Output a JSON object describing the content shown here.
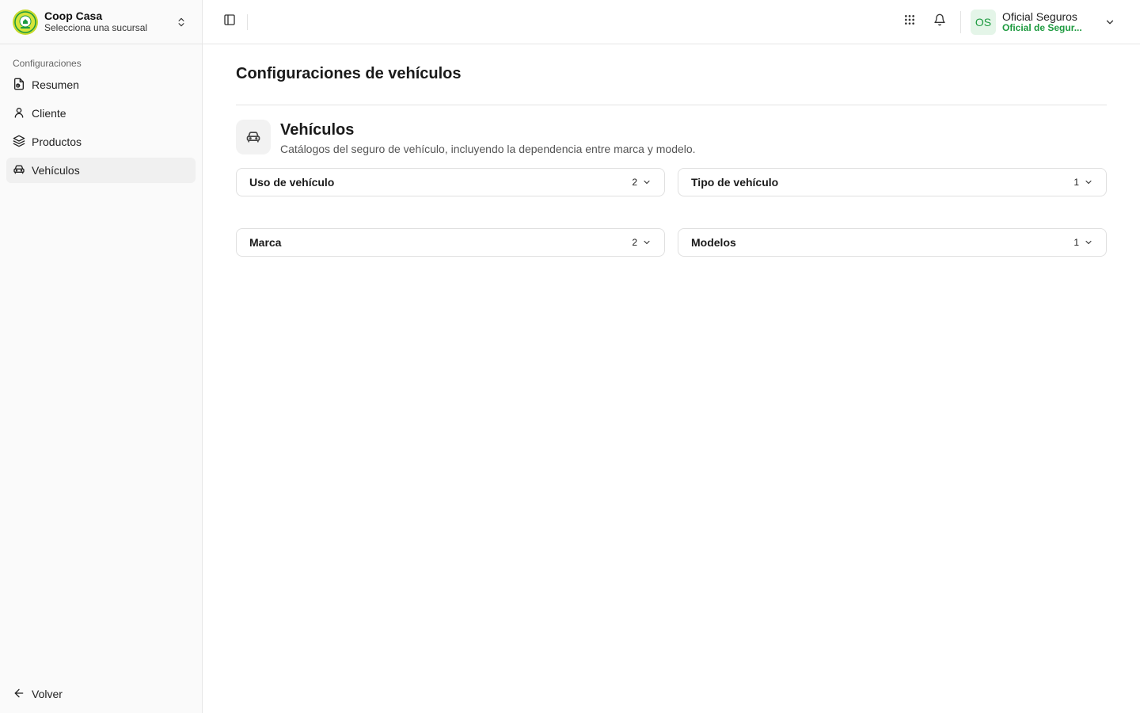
{
  "sidebar": {
    "brand": {
      "name": "Coop Casa",
      "subtitle": "Selecciona una sucursal",
      "logo_text": "COOP CASA"
    },
    "section_label": "Configuraciones",
    "items": [
      {
        "label": "Resumen",
        "icon": "file-chart-icon",
        "active": false
      },
      {
        "label": "Cliente",
        "icon": "user-icon",
        "active": false
      },
      {
        "label": "Productos",
        "icon": "layers-icon",
        "active": false
      },
      {
        "label": "Vehículos",
        "icon": "car-icon",
        "active": true
      }
    ],
    "back_label": "Volver"
  },
  "topbar": {
    "user": {
      "initials": "OS",
      "name": "Oficial Seguros",
      "role": "Oficial de Segur..."
    }
  },
  "main": {
    "title": "Configuraciones de vehículos",
    "section": {
      "title": "Vehículos",
      "description": "Catálogos del seguro de vehículo, incluyendo la dependencia entre marca y modelo."
    },
    "catalogs": [
      {
        "label": "Uso de vehículo",
        "count": "2"
      },
      {
        "label": "Tipo de vehículo",
        "count": "1"
      },
      {
        "label": "Marca",
        "count": "2"
      },
      {
        "label": "Modelos",
        "count": "1"
      }
    ]
  },
  "colors": {
    "accent_green": "#1d9a3f",
    "avatar_bg": "#e4f5e8",
    "logo_bg": "#c7d92b"
  }
}
